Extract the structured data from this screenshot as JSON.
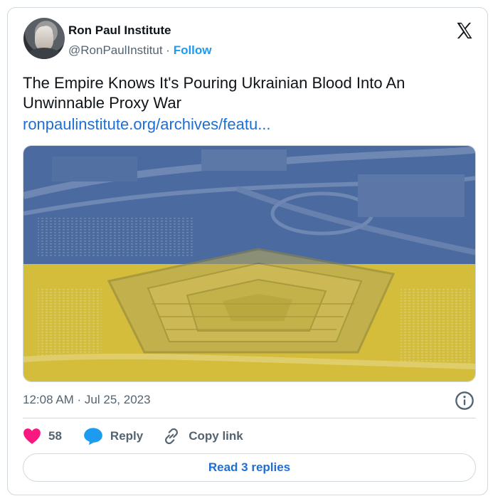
{
  "author": {
    "display_name": "Ron Paul Institute",
    "handle": "@RonPaulInstitut",
    "separator": "·",
    "follow_label": "Follow"
  },
  "tweet": {
    "text": "The Empire Knows It's Pouring Ukrainian Blood Into An Unwinnable Proxy War",
    "link": "ronpaulinstitute.org/archives/featu...",
    "timestamp": "12:08 AM · Jul 25, 2023"
  },
  "media": {
    "description_icon": "pentagon-ukraine-flag-image",
    "flag_colors": {
      "top": "#3a5f9a",
      "bottom": "#d8bf2a"
    }
  },
  "actions": {
    "like_count": "58",
    "reply_label": "Reply",
    "copy_link_label": "Copy link",
    "read_replies_label": "Read 3 replies"
  },
  "colors": {
    "accent": "#1d9bf0",
    "link": "#1d6fd6",
    "like": "#f91880",
    "muted": "#536471"
  }
}
